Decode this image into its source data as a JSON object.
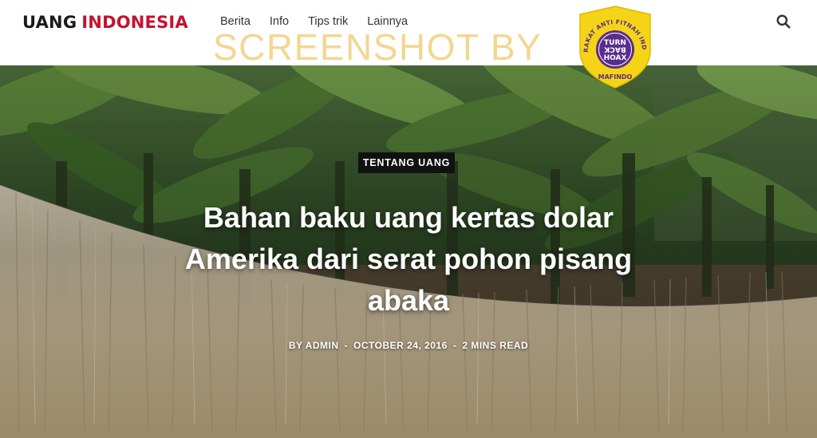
{
  "header": {
    "logo": {
      "word1": "UANG",
      "word2": "INDONESIA"
    },
    "nav": [
      {
        "label": "Berita"
      },
      {
        "label": "Info"
      },
      {
        "label": "Tips trik"
      },
      {
        "label": "Lainnya"
      }
    ],
    "search_icon": "search-icon"
  },
  "watermark": {
    "text": "SCREENSHOT BY",
    "seal": {
      "arc_text": "MASYARAKAT ANTI FITNAH INDONESIA",
      "line1": "TURN",
      "line2": "BACK",
      "line3": "HOAX",
      "org": "MAFINDO"
    }
  },
  "article": {
    "category": "TENTANG UANG",
    "title_lines": [
      "Bahan baku uang kertas dolar",
      "Amerika dari serat pohon pisang",
      "abaka"
    ],
    "meta": {
      "author": "BY ADMIN",
      "date": "OCTOBER 24, 2016",
      "read_time": "2 MINS READ",
      "separator": "-"
    }
  },
  "colors": {
    "logo_dark": "#1b1b1b",
    "logo_accent": "#c8102e",
    "badge_bg": "#111111",
    "watermark": "#f2d58c",
    "seal_yellow": "#f5d417",
    "seal_purple": "#5a2d8a"
  }
}
